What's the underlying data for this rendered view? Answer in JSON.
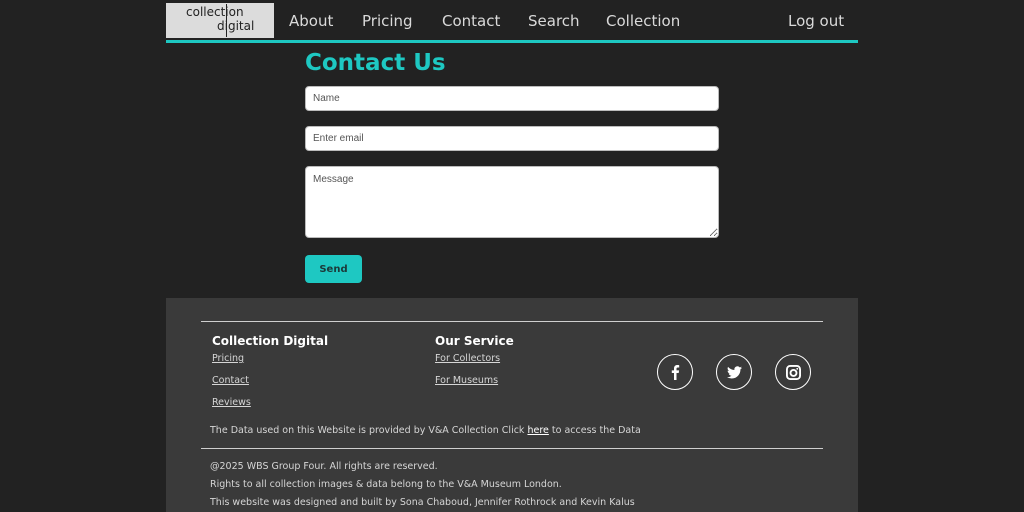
{
  "logo": {
    "line1": "collection",
    "line2": "digital"
  },
  "nav": {
    "about": "About",
    "pricing": "Pricing",
    "contact": "Contact",
    "search": "Search",
    "collection": "Collection",
    "logout": "Log out"
  },
  "form": {
    "title": "Contact Us",
    "name_placeholder": "Name",
    "email_placeholder": "Enter email",
    "message_placeholder": "Message",
    "send_label": "Send"
  },
  "footer": {
    "col1": {
      "heading": "Collection Digital",
      "links": [
        "Pricing",
        "Contact",
        "Reviews"
      ]
    },
    "col2": {
      "heading": "Our Service",
      "links": [
        "For Collectors",
        "For Museums"
      ]
    },
    "social": [
      "facebook-icon",
      "twitter-icon",
      "instagram-icon"
    ],
    "data_text_before": "The Data used on this Website is provided by V&A Collection Click ",
    "data_link": "here",
    "data_text_after": " to access the Data",
    "copyright": "@2025 WBS Group Four. All rights are reserved.",
    "rights": "Rights to all collection images & data belong to the V&A Museum London.",
    "credits": "This website was designed and built by Sona Chaboud, Jennifer Rothrock and Kevin Kalus"
  },
  "colors": {
    "accent": "#1ec8c2",
    "background": "#222222",
    "footer": "#3a3a3a"
  }
}
